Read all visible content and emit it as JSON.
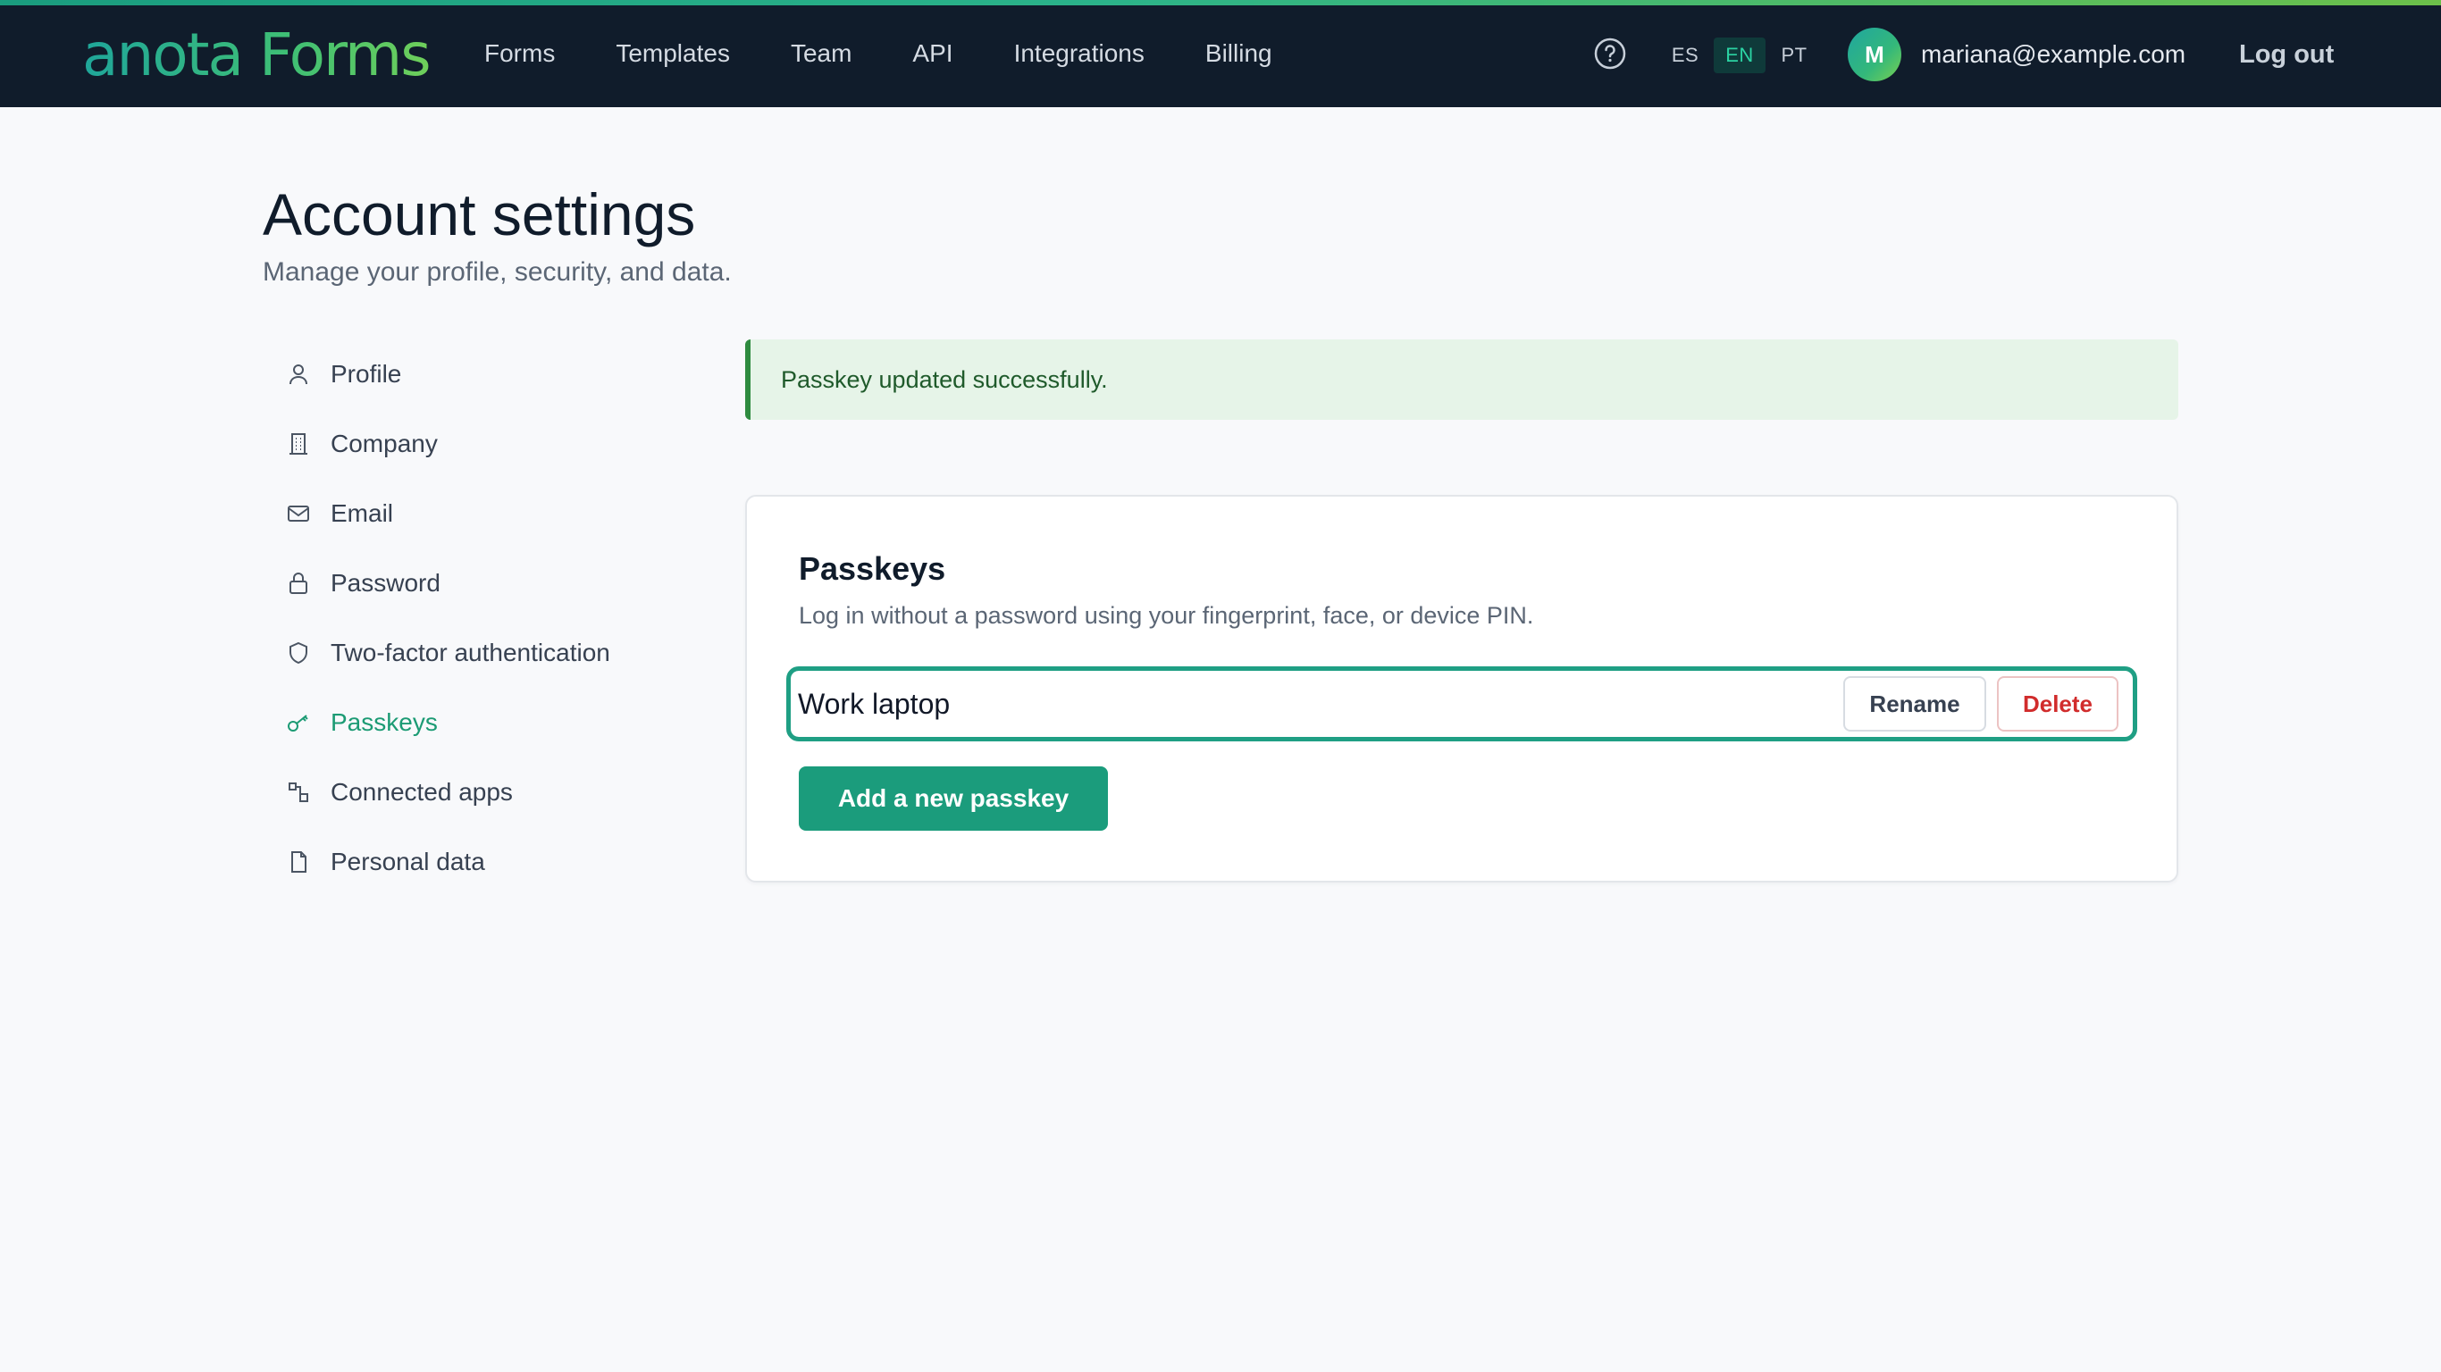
{
  "header": {
    "logo": "anota Forms",
    "nav": [
      "Forms",
      "Templates",
      "Team",
      "API",
      "Integrations",
      "Billing"
    ],
    "help_icon": "help-circle-icon",
    "languages": [
      "ES",
      "EN",
      "PT"
    ],
    "active_language": "EN",
    "avatar_initial": "M",
    "user_email": "mariana@example.com",
    "logout_label": "Log out"
  },
  "page": {
    "title": "Account settings",
    "subtitle": "Manage your profile, security, and data."
  },
  "sidebar": {
    "items": [
      {
        "label": "Profile",
        "icon": "user-icon"
      },
      {
        "label": "Company",
        "icon": "building-icon"
      },
      {
        "label": "Email",
        "icon": "envelope-icon"
      },
      {
        "label": "Password",
        "icon": "lock-icon"
      },
      {
        "label": "Two-factor authentication",
        "icon": "shield-icon"
      },
      {
        "label": "Passkeys",
        "icon": "key-icon",
        "active": true
      },
      {
        "label": "Connected apps",
        "icon": "connected-apps-icon"
      },
      {
        "label": "Personal data",
        "icon": "document-icon"
      }
    ]
  },
  "alert": {
    "message": "Passkey updated successfully."
  },
  "passkeys": {
    "title": "Passkeys",
    "description": "Log in without a password using your fingerprint, face, or device PIN.",
    "items": [
      {
        "name": "Work laptop"
      }
    ],
    "rename_label": "Rename",
    "delete_label": "Delete",
    "add_label": "Add a new passkey"
  },
  "colors": {
    "nav_bg": "#101c2b",
    "accent": "#1b9c7c",
    "active_sidebar": "#1c9b74",
    "success_bg": "#e6f4e8",
    "success_border": "#2e8b3f",
    "danger": "#d12c2c"
  }
}
